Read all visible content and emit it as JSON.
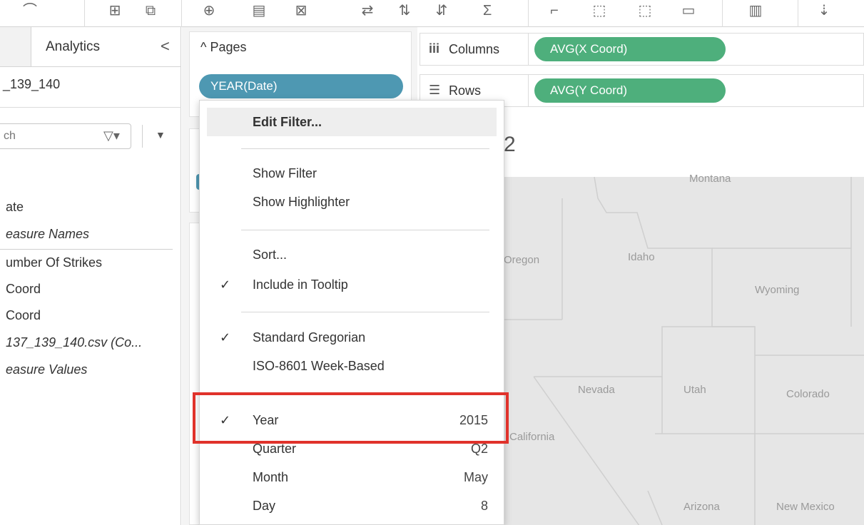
{
  "left_pane": {
    "tab_analytics": "Analytics",
    "collapse_glyph": "<",
    "datasource": "_139_140",
    "search_placeholder": "ch",
    "fields": [
      {
        "label": "ate",
        "italic": false
      },
      {
        "label": "easure Names",
        "italic": true
      },
      {
        "label": "umber Of Strikes",
        "italic": false
      },
      {
        "label": "Coord",
        "italic": false
      },
      {
        "label": "Coord",
        "italic": false
      },
      {
        "label": "137_139_140.csv (Co...",
        "italic": true
      },
      {
        "label": "easure Values",
        "italic": true
      }
    ]
  },
  "pages": {
    "header": "Pages",
    "pill": "YEAR(Date)"
  },
  "shelves": {
    "columns_label": "Columns",
    "columns_pill": "AVG(X Coord)",
    "rows_label": "Rows",
    "rows_pill": "AVG(Y Coord)"
  },
  "viz": {
    "title_fragment": "2",
    "states": [
      "Montana",
      "Oregon",
      "Idaho",
      "Wyoming",
      "Nevada",
      "Utah",
      "Colorado",
      "California",
      "Arizona",
      "New Mexico"
    ]
  },
  "menu": {
    "edit_filter": "Edit Filter...",
    "show_filter": "Show Filter",
    "show_highlighter": "Show Highlighter",
    "sort": "Sort...",
    "include_tooltip": "Include in Tooltip",
    "standard_gregorian": "Standard Gregorian",
    "iso_week": "ISO-8601 Week-Based",
    "year_label": "Year",
    "year_value": "2015",
    "quarter_label": "Quarter",
    "quarter_value": "Q2",
    "month_label": "Month",
    "month_value": "May",
    "day_label": "Day",
    "day_value": "8",
    "check_glyph": "✓"
  },
  "colors": {
    "pages_pill": "#4e98b2",
    "shelf_pill": "#4eaf7c",
    "highlight": "#e0322b"
  },
  "icons": [
    "filter-icon",
    "caret-down-icon",
    "chevron-up-icon",
    "columns-icon",
    "rows-icon",
    "check-icon"
  ]
}
